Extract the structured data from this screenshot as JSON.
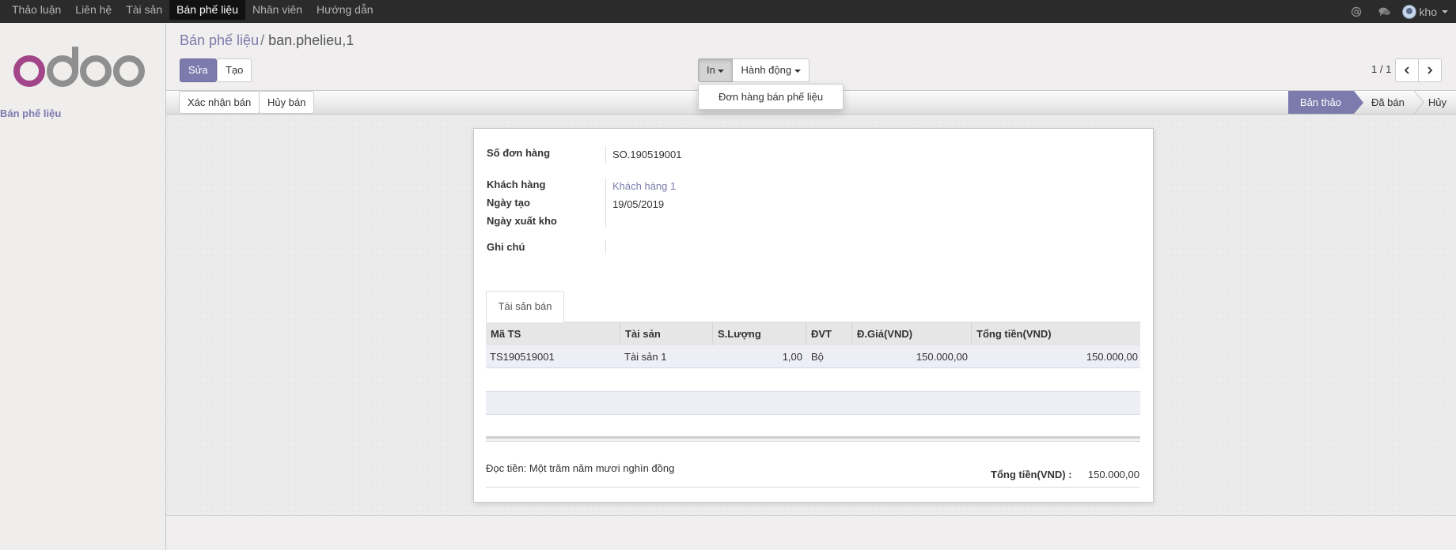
{
  "topnav": {
    "items": [
      "Thảo luận",
      "Liên hệ",
      "Tài sản",
      "Bán phế liệu",
      "Nhân viên",
      "Hướng dẫn"
    ],
    "active_index": 3,
    "user_name": "kho",
    "icons": [
      "at-icon",
      "chat-icon",
      "avatar"
    ]
  },
  "sidebar": {
    "logo_text": "odoo",
    "menu_item": "Bán phế liệu"
  },
  "breadcrumb": {
    "parent": "Bán phế liệu",
    "separator": "/",
    "current": "ban.phelieu,1"
  },
  "buttons": {
    "edit": "Sửa",
    "create": "Tạo",
    "print": "In",
    "action": "Hành động",
    "print_menu_item": "Đơn hàng bán phế liệu"
  },
  "pager": {
    "text": "1 / 1"
  },
  "status_buttons": {
    "confirm": "Xác nhận bán",
    "cancel": "Hủy bán"
  },
  "stages": {
    "items": [
      "Bản thảo",
      "Đã bán",
      "Hủy"
    ],
    "current_index": 0
  },
  "form": {
    "order_no_label": "Số đơn hàng",
    "order_no": "SO.190519001",
    "customer_label": "Khách hàng",
    "customer": "Khách hàng 1",
    "created_label": "Ngày tạo",
    "created": "19/05/2019",
    "export_label": "Ngày xuất kho",
    "export": "",
    "note_label": "Ghi chú",
    "note": ""
  },
  "tab": {
    "label": "Tài sản bán"
  },
  "table": {
    "columns": [
      "Mã TS",
      "Tài sản",
      "S.Lượng",
      "ĐVT",
      "Đ.Giá(VND)",
      "Tổng tiền(VND)"
    ],
    "rows": [
      [
        "TS190519001",
        "Tài sản 1",
        "1,00",
        "Bộ",
        "150.000,00",
        "150.000,00"
      ]
    ]
  },
  "summary": {
    "amount_in_words": "Đọc tiền: Một trăm năm mươi nghìn đồng",
    "total_label": "Tổng tiền(VND) :",
    "total_value": "150.000,00"
  },
  "colors": {
    "brand": "#7c7bad",
    "topbar": "#2b2b2b",
    "logo_o": "#a24689"
  }
}
